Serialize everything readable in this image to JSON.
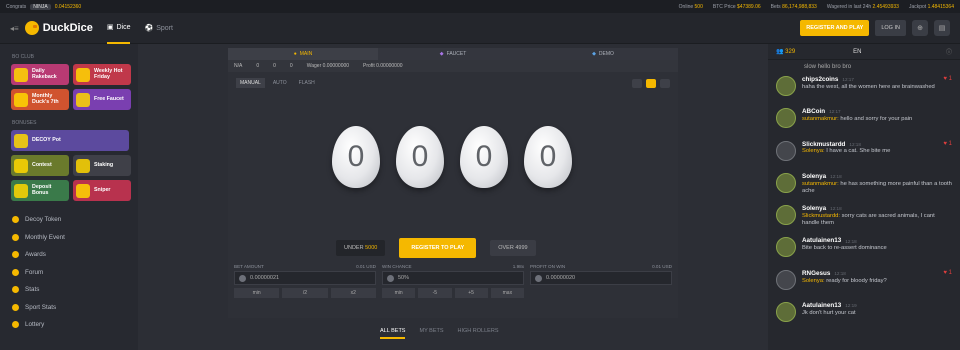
{
  "topbar": {
    "congrats": "Congrats",
    "user": "NINJA",
    "win": "0.04152360",
    "online_label": "Online",
    "online": "500",
    "btc_label": "BTC Price",
    "btc": "$47389.06",
    "bets_label": "Bets",
    "bets": "86,174,988,833",
    "wagered_label": "Wagered in last 24h",
    "wagered": "2.45493933",
    "jackpot_label": "Jackpot",
    "jackpot": "1.48415364"
  },
  "header": {
    "logo": "DuckDice",
    "tabs": [
      "Dice",
      "Sport"
    ],
    "register": "REGISTER AND PLAY",
    "login": "LOG IN"
  },
  "sidebar": {
    "sec_club": "BO CLUB",
    "cards": [
      "Daily Rakeback",
      "Weekly Hot Friday",
      "Monthly Duck's 7th",
      "Free Faucet"
    ],
    "sec_bonuses": "BONUSES",
    "wide": [
      "DECOY Pot"
    ],
    "cards2": [
      "Contest",
      "Staking",
      "Deposit Bonus",
      "Sniper"
    ],
    "menu": [
      "Decoy Token",
      "Monthly Event",
      "Awards",
      "Forum",
      "Stats",
      "Sport Stats",
      "Lottery"
    ]
  },
  "game": {
    "tabs": [
      "MAIN",
      "FAUCET",
      "DEMO"
    ],
    "stats": {
      "s1": "N/A",
      "s2": "0",
      "s3": "0",
      "s4": "0",
      "wager_label": "Wager",
      "wager": "0.00000000",
      "profit_label": "Profit",
      "profit": "0.00000000"
    },
    "modes": [
      "MANUAL",
      "AUTO",
      "FLASH"
    ],
    "eggs": [
      "0",
      "0",
      "0",
      "0"
    ],
    "under_label": "UNDER",
    "under_value": "5000",
    "register": "REGISTER TO PLAY",
    "over": "OVER 4999",
    "fields": [
      {
        "label": "BET AMOUNT",
        "hint": "0.01 USD",
        "value": "0.00000021",
        "buttons": [
          "min",
          "/2",
          "x2"
        ]
      },
      {
        "label": "WIN CHANCE",
        "hint": "1.98x",
        "value": "50%",
        "buttons": [
          "min",
          "-5",
          "+5",
          "max"
        ]
      },
      {
        "label": "PROFIT ON WIN",
        "hint": "0.01 USD",
        "value": "0.00000020",
        "buttons": []
      }
    ],
    "bet_tabs": [
      "ALL BETS",
      "MY BETS",
      "HIGH ROLLERS"
    ]
  },
  "chat": {
    "online": "329",
    "lang": "EN",
    "first": "slow hello bro bro",
    "messages": [
      {
        "user": "chips2coins",
        "time": "12:17",
        "text": "haha the west, all the women here are brainwashed",
        "mention": "",
        "heart": "1"
      },
      {
        "user": "ABCoin",
        "time": "12:17",
        "mention": "sutanmakmur:",
        "text": "hello and sorry for your pain",
        "heart": ""
      },
      {
        "user": "Slickmustardd",
        "time": "12:18",
        "mention": "Solenya:",
        "text": "I have a cat. She bite me",
        "heart": "1"
      },
      {
        "user": "Solenya",
        "time": "12:18",
        "mention": "sutanmakmur:",
        "text": "he has something more painful than a tooth ache",
        "heart": ""
      },
      {
        "user": "Solenya",
        "time": "12:18",
        "mention": "Slickmustardd:",
        "text": "sorry cats are sacred animals, I cant handle them",
        "heart": ""
      },
      {
        "user": "Aatulainen13",
        "time": "12:18",
        "mention": "",
        "text": "Bite back to re-assert dominance",
        "heart": ""
      },
      {
        "user": "RNGesus",
        "time": "12:18",
        "mention": "Solenya:",
        "text": "ready for bloody friday?",
        "heart": "1"
      },
      {
        "user": "Aatulainen13",
        "time": "12:19",
        "mention": "",
        "text": "Jk don't hurt your cat",
        "heart": ""
      }
    ]
  }
}
